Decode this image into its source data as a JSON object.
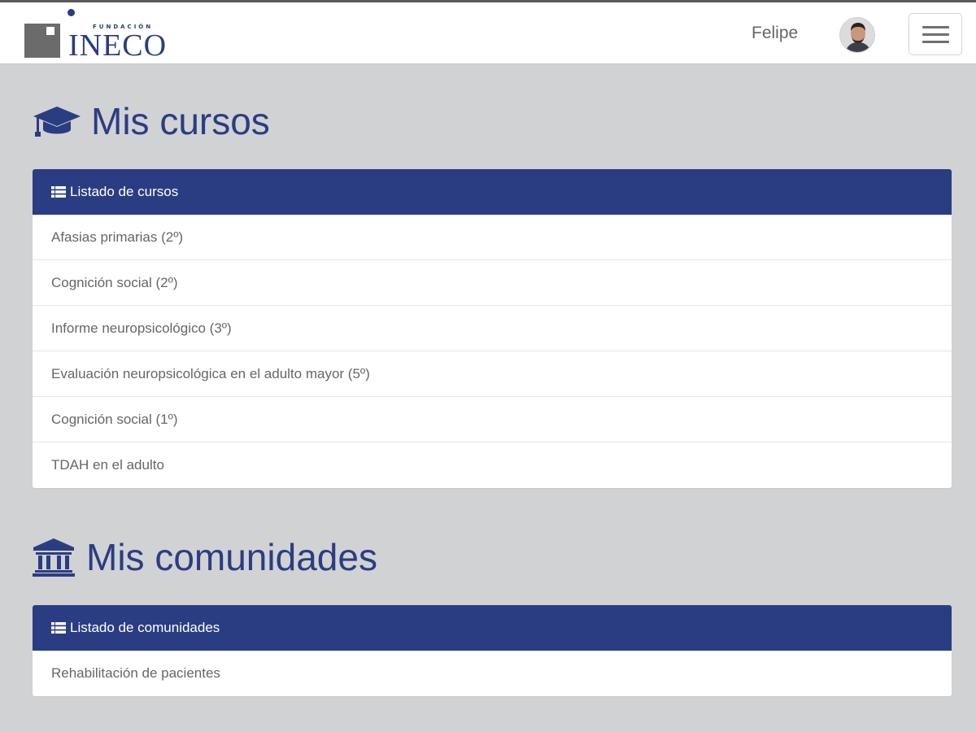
{
  "header": {
    "logo_small": "FUNDACIÓN",
    "logo_big": "INECO",
    "username": "Felipe"
  },
  "courses": {
    "title": "Mis cursos",
    "panel_title": "Listado de cursos",
    "items": [
      {
        "label": "Afasias primarias (2º)"
      },
      {
        "label": "Cognición social (2º)"
      },
      {
        "label": "Informe neuropsicológico (3º)"
      },
      {
        "label": "Evaluación neuropsicológica en el adulto mayor (5º)"
      },
      {
        "label": "Cognición social (1º)"
      },
      {
        "label": "TDAH en el adulto"
      }
    ]
  },
  "communities": {
    "title": "Mis comunidades",
    "panel_title": "Listado de comunidades",
    "items": [
      {
        "label": "Rehabilitación de pacientes"
      }
    ]
  },
  "icons": {
    "courses": "graduation-cap-icon",
    "communities": "institution-icon",
    "panel": "list-icon",
    "menu": "hamburger-icon"
  },
  "colors": {
    "brand": "#2b3d82",
    "background": "#d1d2d4",
    "text_muted": "#666666"
  }
}
